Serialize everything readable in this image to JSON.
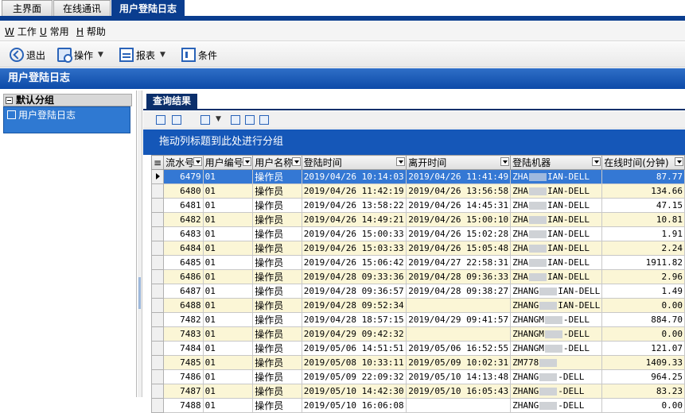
{
  "tabs": [
    {
      "label": "主界面",
      "active": false
    },
    {
      "label": "在线通讯",
      "active": false
    },
    {
      "label": "用户登陆日志",
      "active": true
    }
  ],
  "menu": [
    {
      "key": "W",
      "label": "工作"
    },
    {
      "key": "U",
      "label": "常用"
    },
    {
      "key": "H",
      "label": "帮助"
    }
  ],
  "toolbar": {
    "exit": "退出",
    "operate": "操作",
    "report": "报表",
    "condition": "条件"
  },
  "page_title": "用户登陆日志",
  "left": {
    "group_header": "默认分组",
    "group_item": "用户登陆日志"
  },
  "results_tab": "查询结果",
  "group_hint": "拖动列标题到此处进行分组",
  "columns": [
    "流水号",
    "用户编号",
    "用户名称",
    "登陆时间",
    "离开时间",
    "登陆机器",
    "在线时间(分钟)"
  ],
  "rows": [
    {
      "id": "6479",
      "user": "01",
      "name": "操作员",
      "login": "2019/04/26 10:14:03",
      "logout": "2019/04/26 11:41:49",
      "m1": "ZHA",
      "m2": "IAN-DELL",
      "mins": "87.77"
    },
    {
      "id": "6480",
      "user": "01",
      "name": "操作员",
      "login": "2019/04/26 11:42:19",
      "logout": "2019/04/26 13:56:58",
      "m1": "ZHA",
      "m2": "IAN-DELL",
      "mins": "134.66"
    },
    {
      "id": "6481",
      "user": "01",
      "name": "操作员",
      "login": "2019/04/26 13:58:22",
      "logout": "2019/04/26 14:45:31",
      "m1": "ZHA",
      "m2": "IAN-DELL",
      "mins": "47.15"
    },
    {
      "id": "6482",
      "user": "01",
      "name": "操作员",
      "login": "2019/04/26 14:49:21",
      "logout": "2019/04/26 15:00:10",
      "m1": "ZHA",
      "m2": "IAN-DELL",
      "mins": "10.81"
    },
    {
      "id": "6483",
      "user": "01",
      "name": "操作员",
      "login": "2019/04/26 15:00:33",
      "logout": "2019/04/26 15:02:28",
      "m1": "ZHA",
      "m2": "IAN-DELL",
      "mins": "1.91"
    },
    {
      "id": "6484",
      "user": "01",
      "name": "操作员",
      "login": "2019/04/26 15:03:33",
      "logout": "2019/04/26 15:05:48",
      "m1": "ZHA",
      "m2": "IAN-DELL",
      "mins": "2.24"
    },
    {
      "id": "6485",
      "user": "01",
      "name": "操作员",
      "login": "2019/04/26 15:06:42",
      "logout": "2019/04/27 22:58:31",
      "m1": "ZHA",
      "m2": "IAN-DELL",
      "mins": "1911.82"
    },
    {
      "id": "6486",
      "user": "01",
      "name": "操作员",
      "login": "2019/04/28 09:33:36",
      "logout": "2019/04/28 09:36:33",
      "m1": "ZHA",
      "m2": "IAN-DELL",
      "mins": "2.96"
    },
    {
      "id": "6487",
      "user": "01",
      "name": "操作员",
      "login": "2019/04/28 09:36:57",
      "logout": "2019/04/28 09:38:27",
      "m1": "ZHANG",
      "m2": "IAN-DELL",
      "mins": "1.49"
    },
    {
      "id": "6488",
      "user": "01",
      "name": "操作员",
      "login": "2019/04/28 09:52:34",
      "logout": "",
      "m1": "ZHANG",
      "m2": "IAN-DELL",
      "mins": "0.00"
    },
    {
      "id": "7482",
      "user": "01",
      "name": "操作员",
      "login": "2019/04/28 18:57:15",
      "logout": "2019/04/29 09:41:57",
      "m1": "ZHANGM",
      "m2": "-DELL",
      "mins": "884.70"
    },
    {
      "id": "7483",
      "user": "01",
      "name": "操作员",
      "login": "2019/04/29 09:42:32",
      "logout": "",
      "m1": "ZHANGM",
      "m2": "-DELL",
      "mins": "0.00"
    },
    {
      "id": "7484",
      "user": "01",
      "name": "操作员",
      "login": "2019/05/06 14:51:51",
      "logout": "2019/05/06 16:52:55",
      "m1": "ZHANGM",
      "m2": "-DELL",
      "mins": "121.07"
    },
    {
      "id": "7485",
      "user": "01",
      "name": "操作员",
      "login": "2019/05/08 10:33:11",
      "logout": "2019/05/09 10:02:31",
      "m1": "ZM778",
      "m2": "",
      "mins": "1409.33"
    },
    {
      "id": "7486",
      "user": "01",
      "name": "操作员",
      "login": "2019/05/09 22:09:32",
      "logout": "2019/05/10 14:13:48",
      "m1": "ZHANG",
      "m2": "-DELL",
      "mins": "964.25"
    },
    {
      "id": "7487",
      "user": "01",
      "name": "操作员",
      "login": "2019/05/10 14:42:30",
      "logout": "2019/05/10 16:05:43",
      "m1": "ZHANG",
      "m2": "-DELL",
      "mins": "83.23"
    },
    {
      "id": "7488",
      "user": "01",
      "name": "操作员",
      "login": "2019/05/10 16:06:08",
      "logout": "",
      "m1": "ZHANG",
      "m2": "-DELL",
      "mins": "0.00"
    }
  ]
}
